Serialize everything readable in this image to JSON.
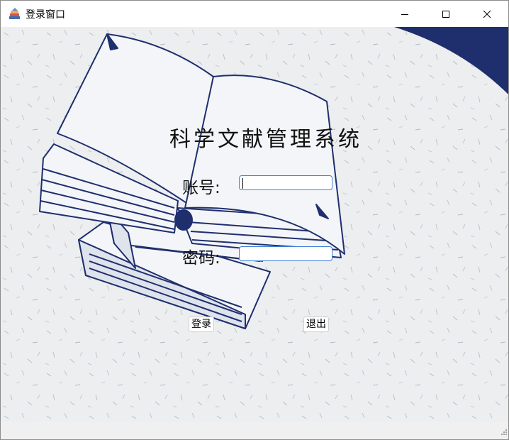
{
  "window": {
    "title": "登录窗口",
    "icon": "books-app-icon",
    "controls": [
      "minimize-icon",
      "maximize-icon",
      "close-icon"
    ]
  },
  "form": {
    "app_title": "科学文献管理系统",
    "account_label": "账号:",
    "account_value": "",
    "password_label": "密码:",
    "password_value": "",
    "login_button": "登录",
    "exit_button": "退出"
  },
  "colors": {
    "accent_blue": "#1f2f6e",
    "field_border": "#3d7fd6",
    "background": "#eceef0"
  }
}
